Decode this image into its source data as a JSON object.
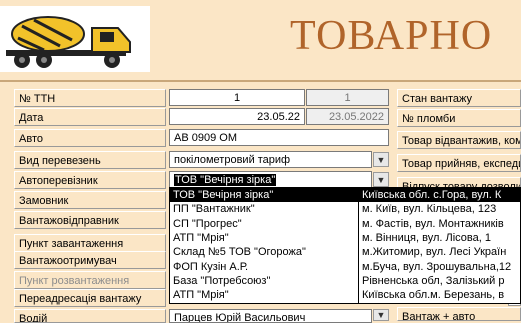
{
  "header": {
    "title": "ТОВАРНО"
  },
  "form": {
    "ttn_label": "№ ТТН",
    "ttn_value": "1",
    "ttn_value2": "1",
    "date_label": "Дата",
    "date_value": "23.05.22",
    "date_value2": "23.05.2022",
    "auto_label": "Авто",
    "auto_value": "АВ 0909 ОМ",
    "transport_type_label": "Вид перевезень",
    "transport_type_value": "покілометровий тариф",
    "carrier_label": "Автоперевізник",
    "carrier_value": "ТОВ \"Вечірня зірка\"",
    "customer_label": "Замовник",
    "sender_label": "Вантажовідправник",
    "loading_point_label": "Пункт завантаження",
    "receiver_label": "Вантажоотримувач",
    "unloading_point_label": "Пункт розвантаження",
    "readdress_label": "Переадресація вантажу",
    "driver_label": "Водій",
    "driver_value": "Парцев Юрій Васильович"
  },
  "right_panel": {
    "cargo_state_label": "Стан вантажу",
    "seal_label": "№ пломби",
    "cargo_released_label": "Товар відвантажив, ком",
    "cargo_received_label": "Товар прийняв, експеди",
    "release_label": "Відпуск товару дозволи",
    "cargo_auto_label": "Вантаж + авто"
  },
  "dropdown": {
    "rows": [
      {
        "name": "ТОВ \"Вечірня зірка\"",
        "address": "Київська обл. с.Гора, вул. К",
        "selected": true
      },
      {
        "name": "ПП \"Вантажник\"",
        "address": "м. Київ, вул. Кільцева, 123",
        "selected": false
      },
      {
        "name": "СП \"Прогрес\"",
        "address": "м. Фастів, вул. Монтажників",
        "selected": false
      },
      {
        "name": "АТП \"Мрія\"",
        "address": "м. Вінниця, вул. Лісова, 1",
        "selected": false
      },
      {
        "name": "Склад №5 ТОВ \"Огорожа\"",
        "address": "м.Житомир, вул. Лесі Україн",
        "selected": false
      },
      {
        "name": "ФОП Кузін А.Р.",
        "address": "м.Буча, вул. Зрошувальна,12",
        "selected": false
      },
      {
        "name": "База \"Потребсоюз\"",
        "address": "Рівненська обл, Залізький р",
        "selected": false
      },
      {
        "name": "АТП \"Мрія\"",
        "address": "Київська обл.м. Березань, в",
        "selected": false
      }
    ]
  }
}
